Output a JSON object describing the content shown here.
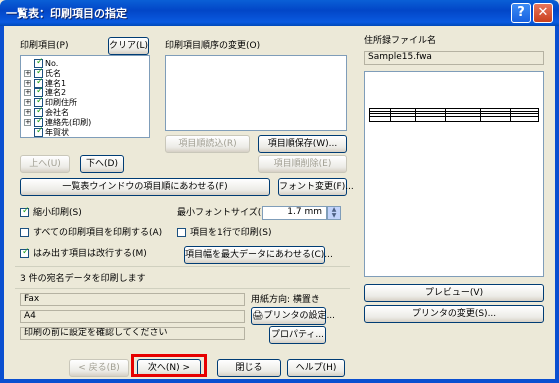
{
  "window": {
    "title": "一覧表：印刷項目の指定",
    "help_btn": "?",
    "close_btn": "✕"
  },
  "print_items": {
    "label": "印刷項目(P)",
    "clear_label": "クリア(L)",
    "tree": [
      {
        "label": "No.",
        "checked": true,
        "expandable": false
      },
      {
        "label": "氏名",
        "checked": true,
        "expandable": true
      },
      {
        "label": "連名1",
        "checked": true,
        "expandable": true
      },
      {
        "label": "連名2",
        "checked": true,
        "expandable": true
      },
      {
        "label": "印刷住所",
        "checked": true,
        "expandable": true
      },
      {
        "label": "会社名",
        "checked": true,
        "expandable": true
      },
      {
        "label": "連絡先(印刷)",
        "checked": true,
        "expandable": true
      },
      {
        "label": "年賀状",
        "checked": true,
        "expandable": false
      }
    ],
    "up_label": "上へ(U)",
    "down_label": "下へ(D)"
  },
  "order_change": {
    "label": "印刷項目順序の変更(O)",
    "load_label": "項目順読込(R)",
    "save_label": "項目順保存(W)...",
    "delete_label": "項目順削除(E)"
  },
  "match_window_order_label": "一覧表ウインドウの項目順にあわせる(F)",
  "font_change_label": "フォント変更(F)...",
  "options": {
    "shrink_print": {
      "label": "縮小印刷(S)",
      "checked": true
    },
    "print_all": {
      "label": "すべての印刷項目を印刷する(A)",
      "checked": false
    },
    "wrap_overflow": {
      "label": "はみ出す項目は改行する(M)",
      "checked": true
    },
    "one_line": {
      "label": "項目を1行で印刷(S)",
      "checked": false
    }
  },
  "min_font": {
    "label": "最小フォントサイズ(I):",
    "value": "1.7 mm"
  },
  "fit_width_label": "項目幅を最大データにあわせる(C)...",
  "address_file": {
    "label": "住所録ファイル名",
    "value": "Sample15.fwa"
  },
  "status_text": "3 件の宛名データを印刷します",
  "printer_info": {
    "printer": "Fax",
    "paper": "A4",
    "direction": "用紙方向: 横置き",
    "note": "印刷の前に設定を確認してください",
    "setup_label": "プリンタの設定...",
    "properties_label": "プロパティ..."
  },
  "preview_label": "プレビュー(V)",
  "printer_change_label": "プリンタの変更(S)...",
  "footer": {
    "back_label": "< 戻る(B)",
    "next_label": "次へ(N) >",
    "close_label": "閉じる",
    "help_label": "ヘルプ(H)"
  }
}
